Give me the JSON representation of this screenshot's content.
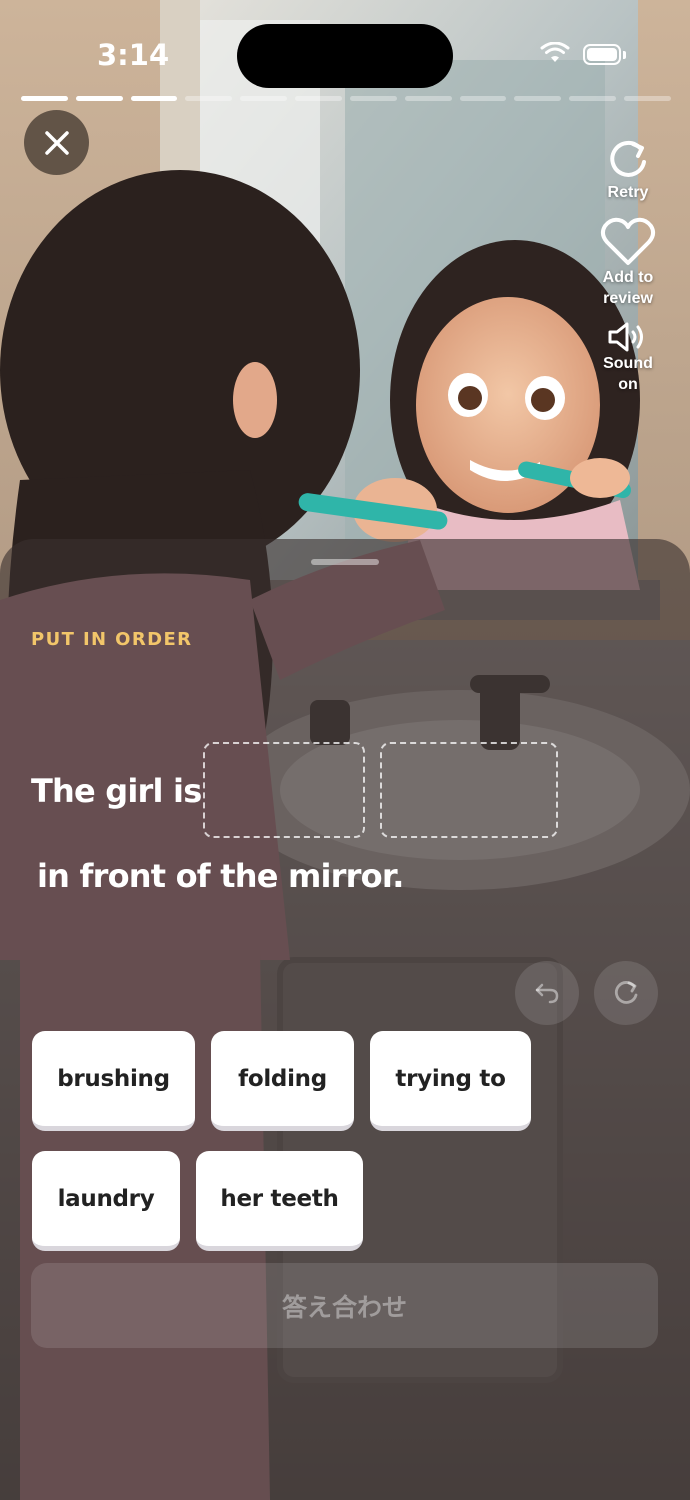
{
  "status_bar": {
    "time": "3:14"
  },
  "progress": {
    "total_steps": 12,
    "completed_steps": 3
  },
  "side_actions": {
    "retry": "Retry",
    "review": "Add to review",
    "sound": "Sound on"
  },
  "exercise": {
    "task_label": "PUT IN ORDER",
    "sentence_start": "The girl is",
    "sentence_end": "in front of the mirror.",
    "word_options": [
      "brushing",
      "folding",
      "trying to",
      "laundry",
      "her teeth"
    ],
    "check_button": "答え合わせ"
  },
  "colors": {
    "task_label": "#f2c66a",
    "chip_background": "#ffffff",
    "sheet_overlay": "#3a302e"
  },
  "icons": {
    "close": "close-icon",
    "retry": "retry-icon",
    "review": "heart-icon",
    "sound": "speaker-icon",
    "undo": "undo-icon",
    "redo": "redo-icon"
  }
}
